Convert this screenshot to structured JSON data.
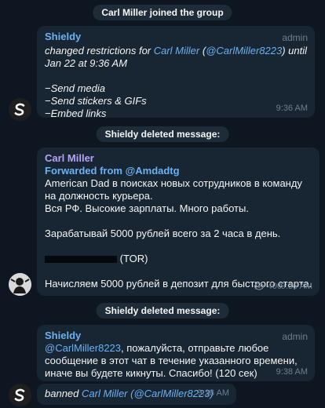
{
  "service1": "Carl Miller joined the group",
  "msg1": {
    "sender": "Shieldy",
    "role": "admin",
    "text_pre": "changed restrictions for ",
    "name": "Carl Miller",
    "handle": "@CarlMiller8223",
    "text_post": " until Jan 22 at 9:36 AM",
    "items": [
      "−Send media",
      "−Send stickers & GIFs",
      "−Embed links"
    ],
    "time": "9:36 AM"
  },
  "service2": "Shieldy deleted message:",
  "msg2": {
    "sender": "Carl Miller",
    "forwarded": "Forwarded from @Amdadtg",
    "p1": "American Dad в поисках новых сотрудников в команду на должность курьера.",
    "p2": "Вся РФ. Высокие зарплаты. Много работы.",
    "p3": "Зарабатывай 5000 рублей всего за 2 часа в день.",
    "tor": "(TOR)",
    "p4": "Начисляем 5000 рублей в депозит для быстрого старта.",
    "views": "400",
    "time": "9:36 AM"
  },
  "service3": "Shieldy deleted message:",
  "msg3": {
    "sender": "Shieldy",
    "role": "admin",
    "handle": "@CarlMiller8223",
    "text": ", пожалуйста, отправьте любое сообщение в этот чат в течение указанного времени, иначе вы будете кикнуты. Спасибо! (120 сек)",
    "time": "9:38 AM"
  },
  "msg4": {
    "pre": "banned ",
    "name": "Carl Miller",
    "handle": "(@CarlMiller8223)",
    "time": "9:38 AM"
  }
}
